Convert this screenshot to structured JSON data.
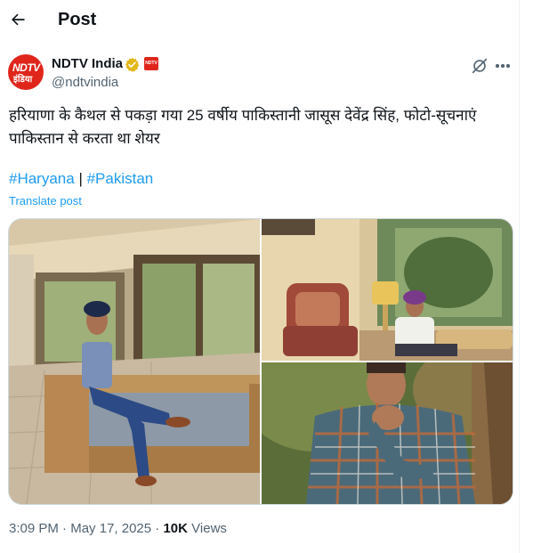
{
  "header": {
    "title": "Post"
  },
  "author": {
    "name": "NDTV India",
    "handle": "@ndtvindia",
    "avatar_text_top": "NDTV",
    "avatar_text_bottom": "इंडिया",
    "affiliate_text": "NDTV"
  },
  "post": {
    "text": "हरियाणा के कैथल से पकड़ा गया 25 वर्षीय पाकिस्तानी जासूस देवेंद्र सिंह, फोटो-सूचनाएं पाकिस्तान से करता था शेयर",
    "hashtag_1": "#Haryana",
    "separator": " | ",
    "hashtag_2": "#Pakistan",
    "translate_label": "Translate post"
  },
  "meta": {
    "time": "3:09 PM",
    "dot": " · ",
    "date": "May 17, 2025",
    "views_count": "10K",
    "views_label": " Views"
  },
  "icons": {
    "back": "arrow-left-icon",
    "verified": "gold-verified-badge-icon",
    "grok": "grok-icon",
    "more": "more-horizontal-icon"
  },
  "colors": {
    "accent": "#1d9bf0",
    "text": "#0f1419",
    "secondary": "#536471",
    "verified_gold": "#e2b719",
    "brand_red": "#e0261b"
  }
}
